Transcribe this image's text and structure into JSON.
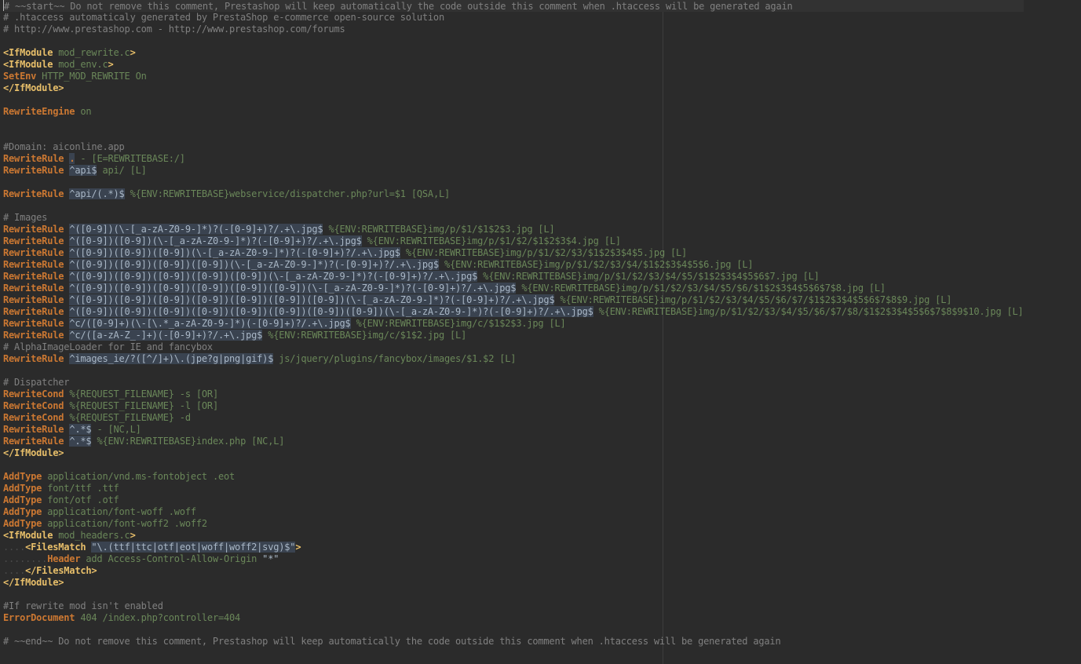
{
  "lines": [
    [
      [
        "cm",
        "# ~~start~~ Do not remove this comment, Prestashop will keep automatically the code outside this comment when .htaccess will be generated again"
      ]
    ],
    [
      [
        "cm",
        "# .htaccess automaticaly generated by PrestaShop e-commerce open-source solution"
      ]
    ],
    [
      [
        "cm",
        "# http://www.prestashop.com - http://www.prestashop.com/forums"
      ]
    ],
    [],
    [
      [
        "tg",
        "<IfModule"
      ],
      [
        "vl",
        " mod_rewrite.c"
      ],
      [
        "tg",
        ">"
      ]
    ],
    [
      [
        "tg",
        "<IfModule"
      ],
      [
        "vl",
        " mod_env.c"
      ],
      [
        "tg",
        ">"
      ]
    ],
    [
      [
        "kw",
        "SetEnv"
      ],
      [
        "vl",
        " HTTP_MOD_REWRITE On"
      ]
    ],
    [
      [
        "tg",
        "</IfModule>"
      ]
    ],
    [],
    [
      [
        "kw",
        "RewriteEngine"
      ],
      [
        "vl",
        " on"
      ]
    ],
    [],
    [],
    [
      [
        "cm",
        "#Domain: aiconline.app"
      ]
    ],
    [
      [
        "kw",
        "RewriteRule"
      ],
      [
        "tx",
        " "
      ],
      [
        "rm",
        "."
      ],
      [
        "vl",
        " - [E=REWRITEBASE:/]"
      ]
    ],
    [
      [
        "kw",
        "RewriteRule"
      ],
      [
        "tx",
        " "
      ],
      [
        "rx",
        "^api$"
      ],
      [
        "vl",
        " api/ [L]"
      ]
    ],
    [],
    [
      [
        "kw",
        "RewriteRule"
      ],
      [
        "tx",
        " "
      ],
      [
        "rx",
        "^api/(.*)$"
      ],
      [
        "vl",
        " %{ENV:REWRITEBASE}webservice/dispatcher.php?url=$1 [QSA,L]"
      ]
    ],
    [],
    [
      [
        "cm",
        "# Images"
      ]
    ],
    [
      [
        "kw",
        "RewriteRule"
      ],
      [
        "tx",
        " "
      ],
      [
        "rx",
        "^([0-9])(\\-[_a-zA-Z0-9-]*)?(-[0-9]+)?/.+\\.jpg$"
      ],
      [
        "vl",
        " %{ENV:REWRITEBASE}img/p/$1/$1$2$3.jpg [L]"
      ]
    ],
    [
      [
        "kw",
        "RewriteRule"
      ],
      [
        "tx",
        " "
      ],
      [
        "rx",
        "^([0-9])([0-9])(\\-[_a-zA-Z0-9-]*)?(-[0-9]+)?/.+\\.jpg$"
      ],
      [
        "vl",
        " %{ENV:REWRITEBASE}img/p/$1/$2/$1$2$3$4.jpg [L]"
      ]
    ],
    [
      [
        "kw",
        "RewriteRule"
      ],
      [
        "tx",
        " "
      ],
      [
        "rx",
        "^([0-9])([0-9])([0-9])(\\-[_a-zA-Z0-9-]*)?(-[0-9]+)?/.+\\.jpg$"
      ],
      [
        "vl",
        " %{ENV:REWRITEBASE}img/p/$1/$2/$3/$1$2$3$4$5.jpg [L]"
      ]
    ],
    [
      [
        "kw",
        "RewriteRule"
      ],
      [
        "tx",
        " "
      ],
      [
        "rx",
        "^([0-9])([0-9])([0-9])([0-9])(\\-[_a-zA-Z0-9-]*)?(-[0-9]+)?/.+\\.jpg$"
      ],
      [
        "vl",
        " %{ENV:REWRITEBASE}img/p/$1/$2/$3/$4/$1$2$3$4$5$6.jpg [L]"
      ]
    ],
    [
      [
        "kw",
        "RewriteRule"
      ],
      [
        "tx",
        " "
      ],
      [
        "rx",
        "^([0-9])([0-9])([0-9])([0-9])([0-9])(\\-[_a-zA-Z0-9-]*)?(-[0-9]+)?/.+\\.jpg$"
      ],
      [
        "vl",
        " %{ENV:REWRITEBASE}img/p/$1/$2/$3/$4/$5/$1$2$3$4$5$6$7.jpg [L]"
      ]
    ],
    [
      [
        "kw",
        "RewriteRule"
      ],
      [
        "tx",
        " "
      ],
      [
        "rx",
        "^([0-9])([0-9])([0-9])([0-9])([0-9])([0-9])(\\-[_a-zA-Z0-9-]*)?(-[0-9]+)?/.+\\.jpg$"
      ],
      [
        "vl",
        " %{ENV:REWRITEBASE}img/p/$1/$2/$3/$4/$5/$6/$1$2$3$4$5$6$7$8.jpg [L]"
      ]
    ],
    [
      [
        "kw",
        "RewriteRule"
      ],
      [
        "tx",
        " "
      ],
      [
        "rx",
        "^([0-9])([0-9])([0-9])([0-9])([0-9])([0-9])([0-9])(\\-[_a-zA-Z0-9-]*)?(-[0-9]+)?/.+\\.jpg$"
      ],
      [
        "vl",
        " %{ENV:REWRITEBASE}img/p/$1/$2/$3/$4/$5/$6/$7/$1$2$3$4$5$6$7$8$9.jpg [L]"
      ]
    ],
    [
      [
        "kw",
        "RewriteRule"
      ],
      [
        "tx",
        " "
      ],
      [
        "rx",
        "^([0-9])([0-9])([0-9])([0-9])([0-9])([0-9])([0-9])([0-9])(\\-[_a-zA-Z0-9-]*)?(-[0-9]+)?/.+\\.jpg$"
      ],
      [
        "vl",
        " %{ENV:REWRITEBASE}img/p/$1/$2/$3/$4/$5/$6/$7/$8/$1$2$3$4$5$6$7$8$9$10.jpg [L]"
      ]
    ],
    [
      [
        "kw",
        "RewriteRule"
      ],
      [
        "tx",
        " "
      ],
      [
        "rx",
        "^c/([0-9]+)(\\-[\\.*_a-zA-Z0-9-]*)(-[0-9]+)?/.+\\.jpg$"
      ],
      [
        "vl",
        " %{ENV:REWRITEBASE}img/c/$1$2$3.jpg [L]"
      ]
    ],
    [
      [
        "kw",
        "RewriteRule"
      ],
      [
        "tx",
        " "
      ],
      [
        "rx",
        "^c/([a-zA-Z_-]+)(-[0-9]+)?/.+\\.jpg$"
      ],
      [
        "vl",
        " %{ENV:REWRITEBASE}img/c/$1$2.jpg [L]"
      ]
    ],
    [
      [
        "cm",
        "# AlphaImageLoader for IE and fancybox"
      ]
    ],
    [
      [
        "kw",
        "RewriteRule"
      ],
      [
        "tx",
        " "
      ],
      [
        "rx",
        "^images_ie/?([^/]+)\\.(jpe?g|png|gif)$"
      ],
      [
        "vl",
        " js/jquery/plugins/fancybox/images/$1.$2 [L]"
      ]
    ],
    [],
    [
      [
        "cm",
        "# Dispatcher"
      ]
    ],
    [
      [
        "kw",
        "RewriteCond"
      ],
      [
        "tx",
        " "
      ],
      [
        "vl",
        "%{REQUEST_FILENAME} -s [OR]"
      ]
    ],
    [
      [
        "kw",
        "RewriteCond"
      ],
      [
        "tx",
        " "
      ],
      [
        "vl",
        "%{REQUEST_FILENAME} -l [OR]"
      ]
    ],
    [
      [
        "kw",
        "RewriteCond"
      ],
      [
        "tx",
        " "
      ],
      [
        "vl",
        "%{REQUEST_FILENAME} -d"
      ]
    ],
    [
      [
        "kw",
        "RewriteRule"
      ],
      [
        "tx",
        " "
      ],
      [
        "rx",
        "^.*$"
      ],
      [
        "vl",
        " - [NC,L]"
      ]
    ],
    [
      [
        "kw",
        "RewriteRule"
      ],
      [
        "tx",
        " "
      ],
      [
        "rx",
        "^.*$"
      ],
      [
        "vl",
        " %{ENV:REWRITEBASE}index.php [NC,L]"
      ]
    ],
    [
      [
        "tg",
        "</IfModule>"
      ]
    ],
    [],
    [
      [
        "kw",
        "AddType"
      ],
      [
        "vl",
        " application/vnd.ms-fontobject .eot"
      ]
    ],
    [
      [
        "kw",
        "AddType"
      ],
      [
        "vl",
        " font/ttf .ttf"
      ]
    ],
    [
      [
        "kw",
        "AddType"
      ],
      [
        "vl",
        " font/otf .otf"
      ]
    ],
    [
      [
        "kw",
        "AddType"
      ],
      [
        "vl",
        " application/font-woff .woff"
      ]
    ],
    [
      [
        "kw",
        "AddType"
      ],
      [
        "vl",
        " application/font-woff2 .woff2"
      ]
    ],
    [
      [
        "tg",
        "<IfModule"
      ],
      [
        "vl",
        " mod_headers.c"
      ],
      [
        "tg",
        ">"
      ]
    ],
    [
      [
        "ws",
        "...."
      ],
      [
        "tg",
        "<FilesMatch"
      ],
      [
        "tx",
        " "
      ],
      [
        "rx",
        "\"\\.(ttf|ttc|otf|eot|woff|woff2|svg)$\""
      ],
      [
        "tg",
        ">"
      ]
    ],
    [
      [
        "ws",
        "........"
      ],
      [
        "kw",
        "Header"
      ],
      [
        "vl",
        " add Access-Control-Allow-Origin "
      ],
      [
        "tx",
        "\"*\""
      ]
    ],
    [
      [
        "ws",
        "...."
      ],
      [
        "tg",
        "</FilesMatch>"
      ]
    ],
    [
      [
        "tg",
        "</IfModule>"
      ]
    ],
    [],
    [
      [
        "cm",
        "#If rewrite mod isn't enabled"
      ]
    ],
    [
      [
        "kw",
        "ErrorDocument"
      ],
      [
        "vl",
        " 404 /index.php?controller=404"
      ]
    ],
    [],
    [
      [
        "cm",
        "# ~~end~~ Do not remove this comment, Prestashop will keep automatically the code outside this comment when .htaccess will be generated again"
      ]
    ]
  ]
}
